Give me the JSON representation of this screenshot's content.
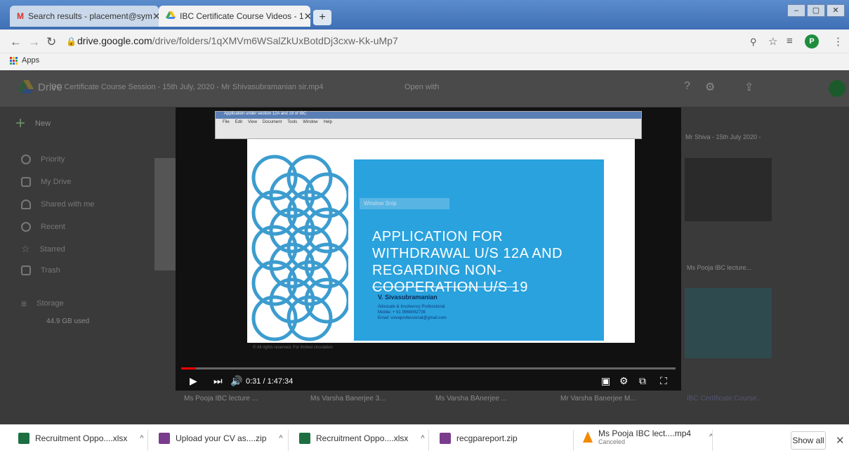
{
  "tabs": [
    {
      "title": "Search results - placement@sym",
      "favicon": "gmail-icon",
      "active": false
    },
    {
      "title": "IBC Certificate Course Videos - 1",
      "favicon": "google-drive-icon",
      "active": true
    }
  ],
  "address": {
    "host": "drive.google.com",
    "path": "/drive/folders/1qXMVm6WSalZkUxBotdDj3cxw-Kk-uMp7"
  },
  "bookmarks": {
    "apps_label": "Apps"
  },
  "drive": {
    "header_title": "IBC Certificate Course Session - 15th July, 2020 - Mr Shivasubramanian sir.mp4",
    "open_with": "Open with",
    "brand": "Drive",
    "new_label": "New",
    "sidebar": [
      "Priority",
      "My Drive",
      "Shared with me",
      "Recent",
      "Starred",
      "Trash"
    ],
    "storage_label": "Storage",
    "storage_used": "44.9 GB used",
    "file_labels": [
      "Ms Pooja IBC lecture ...",
      "Ms Varsha Banerjee 3...",
      "Ms Varsha BAnerjee ...",
      "Mr Varsha Banerjee M...",
      "IBC Certificate Course..."
    ],
    "right_labels": [
      "Ms Pooja IBC lecture...",
      "Mr Shiva - 15th July 2020 -"
    ]
  },
  "slide": {
    "window_title": "Application under section 12A and 19 of IBC",
    "menu": [
      "File",
      "Edit",
      "View",
      "Document",
      "Tools",
      "Window",
      "Help"
    ],
    "snip_label": "Window Snip",
    "title": "APPLICATION FOR WITHDRAWAL U/S 12A AND REGARDING NON-COOPERATION U/S 19",
    "author": "V. Sivasubramanian",
    "role": "Advocate & Insolvency Professional",
    "mobile": "Mobile: + 91 9968062736",
    "email": "Email: vsivaprofessional@gmail.com",
    "footer": "© All rights reserved. For limited circulation"
  },
  "player": {
    "current_time": "0:31",
    "duration": "1:47:34",
    "progress": 0.03
  },
  "downloads": [
    {
      "name": "Recruitment Oppo....xlsx",
      "icon": "excel-icon"
    },
    {
      "name": "Upload your CV as....zip",
      "icon": "zip-icon"
    },
    {
      "name": "Recruitment Oppo....xlsx",
      "icon": "excel-icon"
    },
    {
      "name": "recgpareport.zip",
      "icon": "zip-icon"
    },
    {
      "name": "Ms Pooja IBC lect....mp4",
      "status": "Canceled",
      "icon": "vlc-icon"
    }
  ],
  "show_all_label": "Show all",
  "colors": {
    "slide_blue": "#29a2de",
    "tab_blue": "#3f6fb5",
    "progress_red": "#ff0000"
  }
}
